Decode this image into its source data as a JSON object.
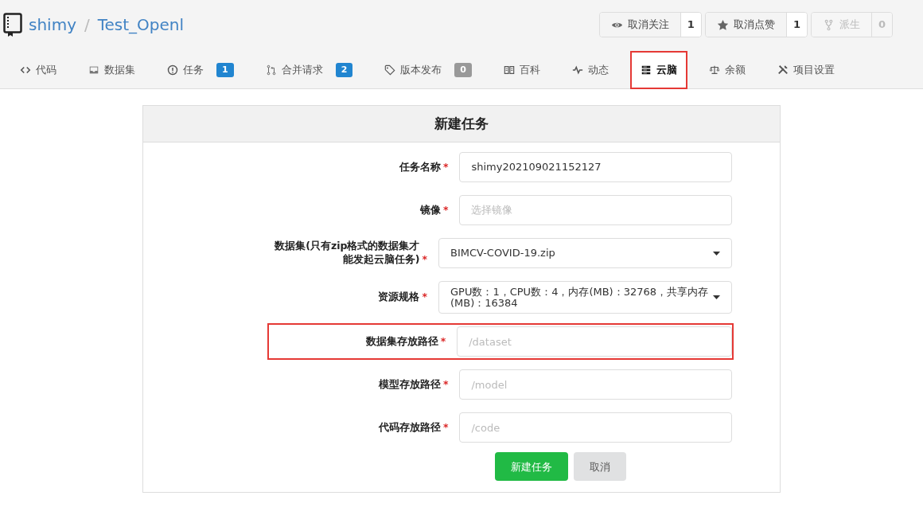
{
  "repo": {
    "owner": "shimy",
    "separator": "/",
    "name": "Test_Openl"
  },
  "repo_buttons": [
    {
      "label": "取消关注",
      "count": "1",
      "disabled": false
    },
    {
      "label": "取消点赞",
      "count": "1",
      "disabled": false
    },
    {
      "label": "派生",
      "count": "0",
      "disabled": true
    }
  ],
  "tabs": [
    {
      "label": "代码",
      "selected": false,
      "highlighted": false
    },
    {
      "label": "数据集",
      "selected": false,
      "highlighted": false
    },
    {
      "label": "任务",
      "badge": "1",
      "selected": false,
      "highlighted": false
    },
    {
      "label": "合并请求",
      "badge": "2",
      "selected": false,
      "highlighted": false
    },
    {
      "label": "版本发布",
      "badge": "0",
      "selected": false,
      "highlighted": false
    },
    {
      "label": "百科",
      "selected": false,
      "highlighted": false
    },
    {
      "label": "动态",
      "selected": false,
      "highlighted": false
    },
    {
      "label": "云脑",
      "selected": true,
      "highlighted": true
    },
    {
      "label": "余额",
      "selected": false,
      "highlighted": false
    },
    {
      "label": "项目设置",
      "selected": false,
      "highlighted": false
    }
  ],
  "form": {
    "title": "新建任务",
    "fields": [
      {
        "kind": "input",
        "label": "任务名称",
        "required_mark": "*",
        "value": "shimy202109021152127",
        "highlighted": false
      },
      {
        "kind": "input",
        "label": "镜像",
        "required_mark": "*",
        "placeholder": "选择镜像",
        "highlighted": false
      },
      {
        "kind": "select",
        "label": "数据集(只有zip格式的数据集才能发起云脑任务)",
        "required_mark": "*",
        "value": "BIMCV-COVID-19.zip",
        "highlighted": false
      },
      {
        "kind": "select",
        "label": "资源规格",
        "required_mark": "*",
        "value": "GPU数：1，CPU数：4，内存(MB)：32768，共享内存(MB)：16384",
        "highlighted": false
      },
      {
        "kind": "input",
        "label": "数据集存放路径",
        "required_mark": "*",
        "placeholder": "/dataset",
        "highlighted": true
      },
      {
        "kind": "input",
        "label": "模型存放路径",
        "required_mark": "*",
        "placeholder": "/model",
        "highlighted": false
      },
      {
        "kind": "input",
        "label": "代码存放路径",
        "required_mark": "*",
        "placeholder": "/code",
        "highlighted": false
      }
    ],
    "buttons": [
      {
        "label": "新建任务",
        "kind": "primary"
      },
      {
        "label": "取消",
        "kind": "secondary"
      }
    ]
  }
}
